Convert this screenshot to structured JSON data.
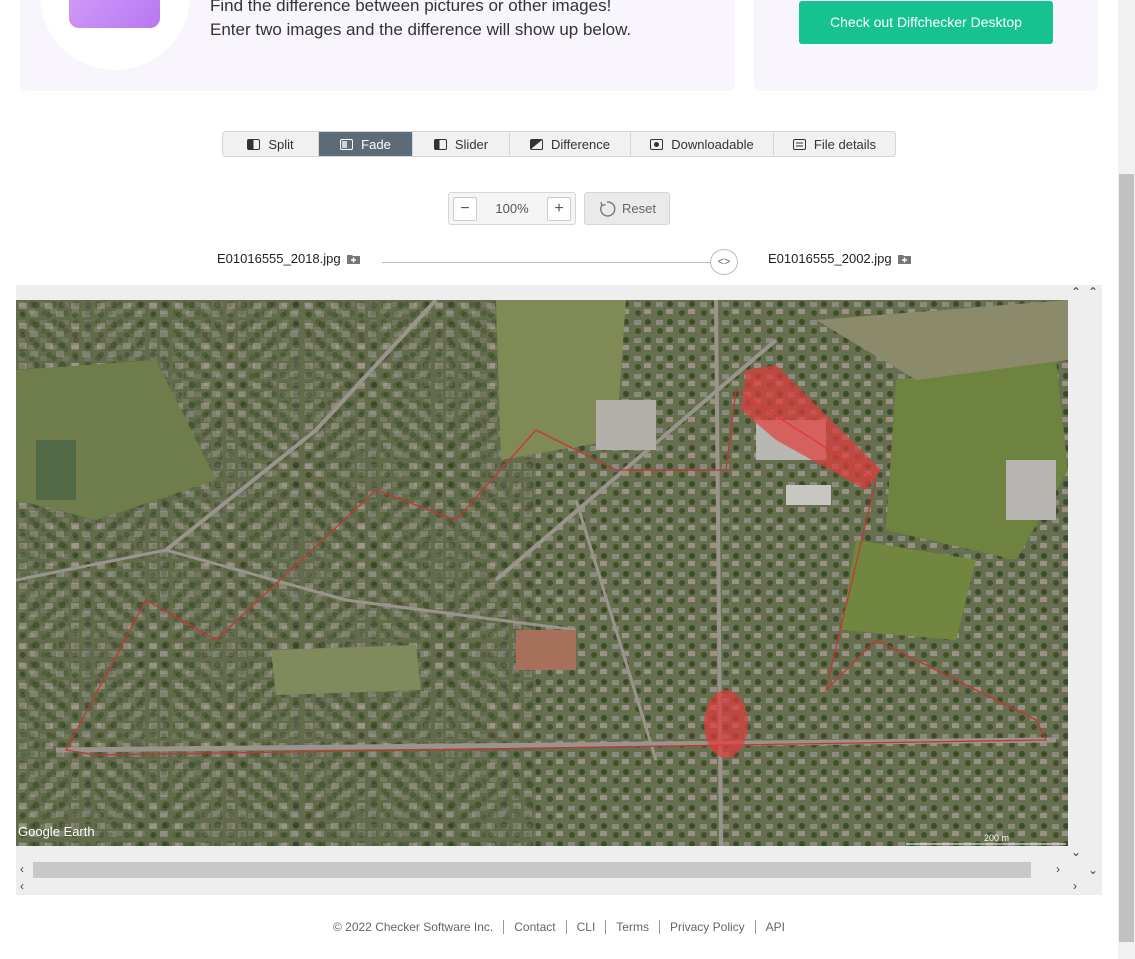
{
  "hero": {
    "line1": "Find the difference between pictures or other images!",
    "line2": "Enter two images and the difference will show up below."
  },
  "cta": {
    "label": "Check out Diffchecker Desktop"
  },
  "tabs": [
    {
      "label": "Split",
      "icon": "split-icon",
      "active": false
    },
    {
      "label": "Fade",
      "icon": "fade-icon",
      "active": true
    },
    {
      "label": "Slider",
      "icon": "slider-icon",
      "active": false
    },
    {
      "label": "Difference",
      "icon": "difference-icon",
      "active": false
    },
    {
      "label": "Downloadable",
      "icon": "download-icon",
      "active": false
    },
    {
      "label": "File details",
      "icon": "file-details-icon",
      "active": false
    }
  ],
  "zoom": {
    "value": "100%",
    "minus": "−",
    "plus": "+"
  },
  "reset": {
    "label": "Reset"
  },
  "files": {
    "left": "E01016555_2018.jpg",
    "right": "E01016555_2002.jpg"
  },
  "slider_handle": "<>",
  "map": {
    "attribution": "Google Earth",
    "scale": "200 m"
  },
  "footer": {
    "copyright": "© 2022 Checker Software Inc.",
    "links": [
      "Contact",
      "CLI",
      "Terms",
      "Privacy Policy",
      "API"
    ]
  },
  "colors": {
    "accent": "#15c290",
    "active_tab": "#5c6b78",
    "highlight": "#e23b3b"
  }
}
